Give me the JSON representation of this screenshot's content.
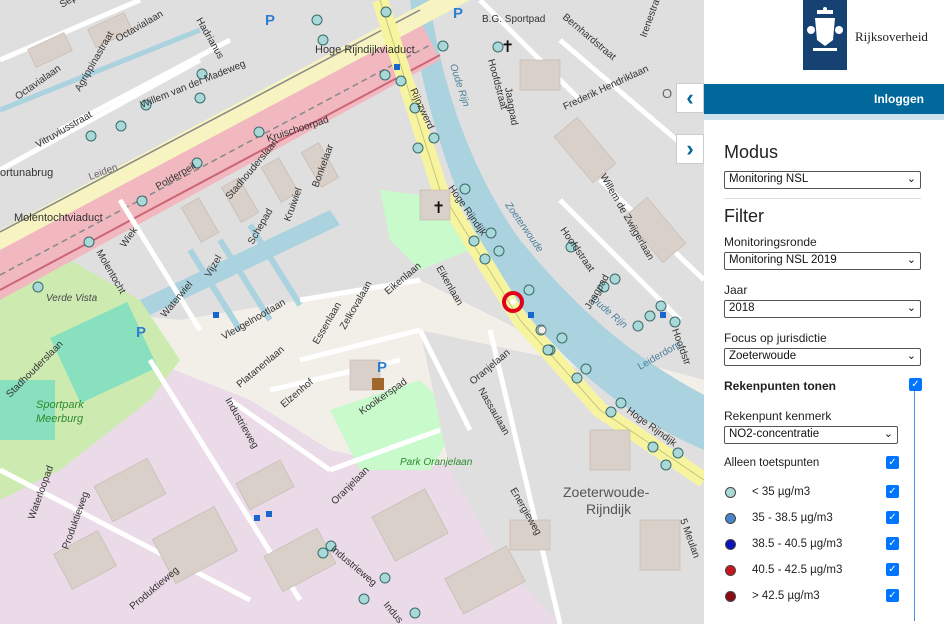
{
  "header": {
    "brand": "Rijksoverheid",
    "login_label": "Inloggen"
  },
  "panel": {
    "modus_title": "Modus",
    "modus_value": "Monitoring NSL",
    "filter_title": "Filter",
    "ronde_label": "Monitoringsronde",
    "ronde_value": "Monitoring NSL 2019",
    "jaar_label": "Jaar",
    "jaar_value": "2018",
    "focus_label": "Focus op jurisdictie",
    "focus_value": "Zoeterwoude",
    "rekenpunten_label": "Rekenpunten tonen",
    "kenmerk_label": "Rekenpunt kenmerk",
    "kenmerk_value": "NO2-concentratie",
    "toetspunten_label": "Alleen toetspunten",
    "legend": [
      {
        "label": "< 35 µg/m3",
        "color": "#a8d8d8"
      },
      {
        "label": "35 - 38.5 µg/m3",
        "color": "#4a84c8"
      },
      {
        "label": "38.5 - 40.5 µg/m3",
        "color": "#0a14b8"
      },
      {
        "label": "40.5 - 42.5 µg/m3",
        "color": "#c8141e"
      },
      {
        "label": "> 42.5 µg/m3",
        "color": "#8c0a12"
      }
    ]
  },
  "map_labels": {
    "willem": "Willem van der Madeweg",
    "hoge_rijndijk_viaduct": "Hoge Rijndijkviaduct",
    "hoge_rijndijk": "Hoge Rijndijk",
    "hoge_rijndijk2": "Hoge Rijndijk",
    "oude_rijn": "Oude Rijn",
    "oude_rijn2": "Oude Rijn",
    "zoeterwoude_river": "Zoeterwoude",
    "molentocht": "Molentochtviaduct",
    "fortuna": "ortunabrug",
    "octavialaan": "Octavialaan",
    "vitruvius": "Vitruviusstraat",
    "agrippina": "Agrippinastraat",
    "octavialaan2": "Octavialaan",
    "kruischoorpad": "Kruischoorpad",
    "stadhouderslaan": "Stadhouderslaan",
    "bonkelaar": "Bonkelaar",
    "kruiwiel": "Kruiwiel",
    "schepad": "Schepad",
    "vijzel": "Vijzel",
    "polderpeil": "Polderpeil",
    "wiek": "Wiek",
    "waterwiel": "Waterwiel",
    "molentocht2": "Molentocht",
    "leiden": "Leiden",
    "verde": "Verde Vista",
    "sportpark": "Sportpark",
    "meerburg": "Meerburg",
    "stadhouderslaan2": "Stadhouderslaan",
    "vleugelnootlaan": "Vleugelnootlaan",
    "zelkovalaan": "Zelkovalaan",
    "essenlaan": "Essenlaan",
    "eikenlaan": "Eikenlaan",
    "eikenlaan2": "Eikenlaan",
    "platanenlaan": "Platanenlaan",
    "elzenhof": "Elzenhof",
    "kooikerspad": "Kooikerspad",
    "park": "Park Oranjelaan",
    "oranjelaan": "Oranjelaan",
    "nassaulaan": "Nassaulaan",
    "oranjelaan2": "Oranjelaan",
    "industrieweg": "Industrieweg",
    "industrieweg2": "Industrieweg",
    "industrieweg3": "Indus",
    "produktieweg": "Produktieweg",
    "produktieweg2": "Produktieweg",
    "waterloopad": "Waterloopad",
    "energieweg": "Energieweg",
    "zoeterwoude_rijndijk1": "Zoeterwoude-",
    "zoeterwoude_rijndijk2": "Rijndijk",
    "rijnzwerd": "Rijnzwerd",
    "hoofdstraat": "Hoofdstraat",
    "jaagpad": "Jaagpad",
    "jaagpad2": "Jaagpad",
    "hoofdstraat2": "Hoofdstraat",
    "hoofdstraat3": "Hoofdstr",
    "bernhard": "Bernhardstraat",
    "frederik": "Frederik Hendriklaan",
    "irene": "Irenestraat",
    "willem_zw": "Willem de Zwijgerlaan",
    "bg_sportpad": "B.G. Sportpad",
    "hadrianus": "Hadrianus",
    "leiderdorp": "Leiderdorp",
    "meulan": "5 Meulan",
    "sep": "Sep",
    "o_letter": "O"
  }
}
